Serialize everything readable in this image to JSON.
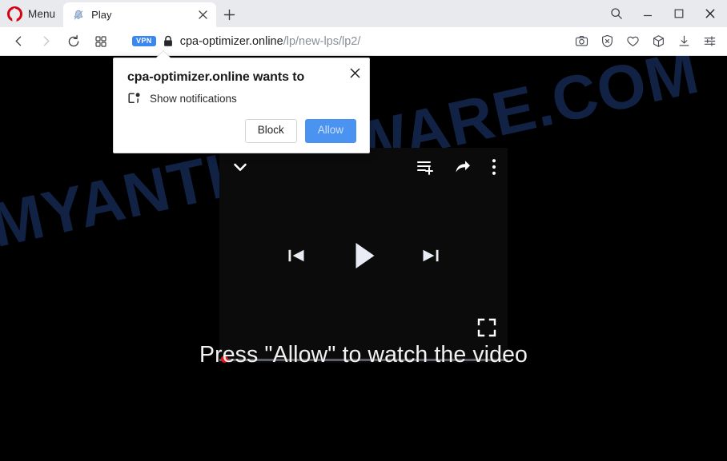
{
  "browser": {
    "menu_label": "Menu",
    "logo_icon": "opera-logo-icon",
    "tab": {
      "title": "Play",
      "favicon_icon": "bell-favicon-icon",
      "close_icon": "close-icon"
    },
    "new_tab_icon": "plus-icon",
    "window_controls": {
      "search_icon": "search-icon",
      "minimize_icon": "minimize-icon",
      "maximize_icon": "maximize-icon",
      "close_icon": "window-close-icon"
    },
    "nav": {
      "back_icon": "chevron-left-icon",
      "forward_icon": "chevron-right-icon",
      "reload_icon": "reload-icon",
      "tab_grid_icon": "grid-squares-icon"
    },
    "address": {
      "vpn_badge": "VPN",
      "lock_icon": "padlock-icon",
      "domain": "cpa-optimizer.online",
      "path": "/lp/new-lps/lp2/"
    },
    "address_actions": [
      {
        "name": "snapshot-icon",
        "label": "Snapshot"
      },
      {
        "name": "adblock-shield-icon",
        "label": "Ad blocker"
      },
      {
        "name": "heart-icon",
        "label": "Favorites"
      },
      {
        "name": "crypto-wallet-cube-icon",
        "label": "Crypto Wallet"
      },
      {
        "name": "downloads-icon",
        "label": "Downloads"
      },
      {
        "name": "easy-setup-sliders-icon",
        "label": "Easy setup"
      }
    ]
  },
  "notification_dialog": {
    "title": "cpa-optimizer.online wants to",
    "permission_icon": "show-notifications-icon",
    "permission_label": "Show notifications",
    "close_icon": "dialog-close-icon",
    "block_label": "Block",
    "allow_label": "Allow",
    "allow_color": "#4b93f0"
  },
  "page": {
    "background_color": "#000000",
    "watermark_text": "MYANTISPYWARE.COM",
    "watermark_color": "#14274f",
    "cta_text": "Press \"Allow\" to watch the video",
    "player": {
      "collapse_icon": "chevron-down-icon",
      "add_to_queue_icon": "add-to-queue-icon",
      "share_icon": "share-arrow-icon",
      "more_options_icon": "more-vertical-dots-icon",
      "previous_icon": "previous-track-icon",
      "play_icon": "play-icon",
      "next_icon": "next-track-icon",
      "fullscreen_icon": "fullscreen-icon",
      "progress_percent": 0,
      "progress_handle_color": "#e8131a"
    }
  }
}
